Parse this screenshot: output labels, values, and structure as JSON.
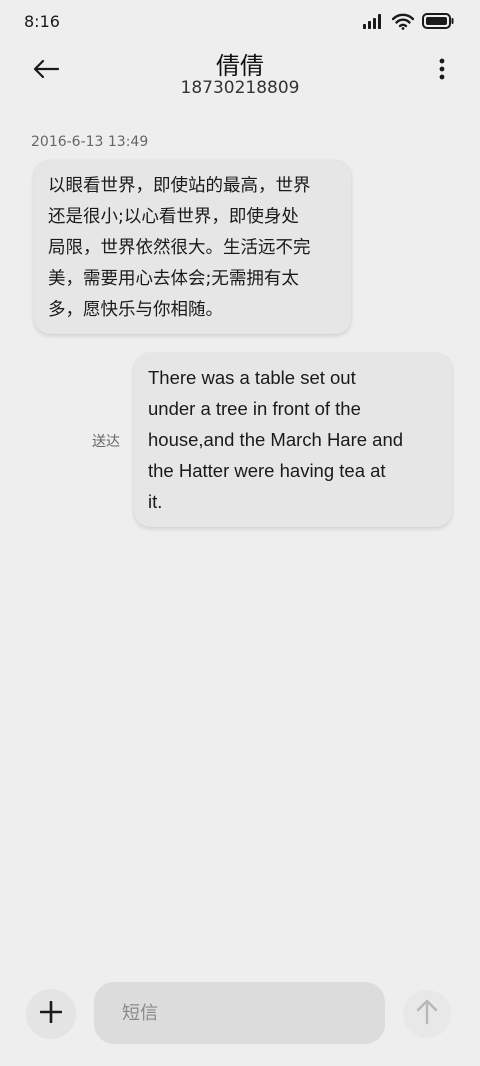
{
  "status_bar": {
    "time": "8:16",
    "icons": [
      "signal-icon",
      "wifi-icon",
      "battery-icon"
    ]
  },
  "header": {
    "title": "倩倩",
    "subtitle": "18730218809",
    "back_icon": "back-arrow-icon",
    "menu_icon": "more-vertical-icon"
  },
  "messages": [
    {
      "direction": "incoming",
      "timestamp": "2016-6-13 13:49",
      "lines": [
        "以眼看世界，即使站的最高，世界",
        "还是很小;以心看世界，即使身处",
        "局限，世界依然很大。生活远不完",
        "美，需要用心去体会;无需拥有太",
        "多，愿快乐与你相随。"
      ]
    },
    {
      "direction": "outgoing",
      "status": "送达",
      "lines": [
        "There was a table set out",
        "under a tree in front of the",
        "house,and the March Hare and",
        "the Hatter were having tea at",
        "it."
      ]
    }
  ],
  "composer": {
    "placeholder": "短信",
    "value": "",
    "add_icon": "plus-icon",
    "send_icon": "arrow-up-icon"
  },
  "colors": {
    "background": "#eeeeee",
    "bubble": "#e6e6e6",
    "input": "#dcdcdc",
    "send_icon": "#b8b8b8"
  }
}
